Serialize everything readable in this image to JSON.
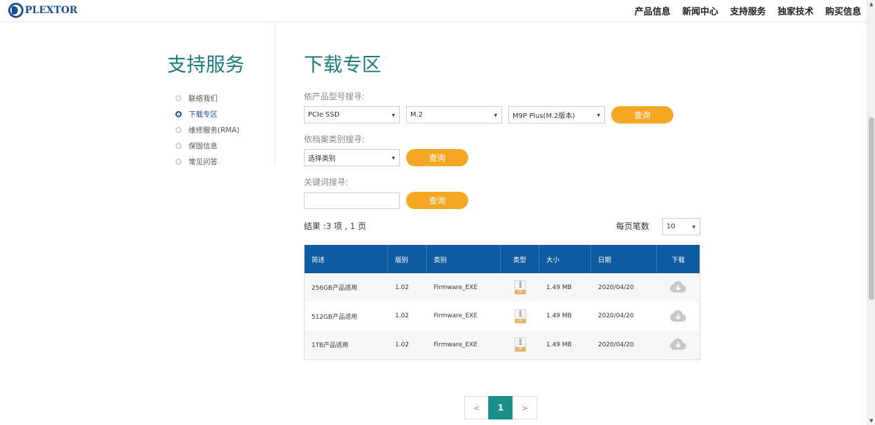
{
  "header": {
    "logo_text": "PLEXTOR",
    "nav": [
      "产品信息",
      "新闻中心",
      "支持服务",
      "独家技术",
      "购买信息"
    ]
  },
  "sidebar": {
    "title": "支持服务",
    "items": [
      {
        "label": "联络我们",
        "active": false
      },
      {
        "label": "下载专区",
        "active": true
      },
      {
        "label": "维修服务(RMA)",
        "active": false
      },
      {
        "label": "保固信息",
        "active": false
      },
      {
        "label": "常见问答",
        "active": false
      }
    ]
  },
  "main": {
    "title": "下载专区",
    "product_search": {
      "label": "依产品型号搜寻:",
      "select1": "PCIe SSD",
      "select2": "M.2",
      "select3": "M9P Plus(M.2版本)",
      "button": "查询"
    },
    "category_search": {
      "label": "依档案类别搜寻:",
      "select": "选择类别",
      "button": "查询"
    },
    "keyword_search": {
      "label": "关键词搜寻:",
      "value": "",
      "button": "查询"
    },
    "results": {
      "prefix": "结果 :",
      "count": "3",
      "mid": " 项 , ",
      "pages": "1",
      "suffix": " 页"
    },
    "per_page": {
      "label": "每页笔数",
      "value": "10"
    },
    "table": {
      "headers": [
        "简述",
        "版别",
        "类别",
        "类型",
        "大小",
        "日期",
        "下载"
      ],
      "rows": [
        {
          "desc": "256GB产品适用",
          "version": "1.02",
          "category": "Firmware_EXE",
          "type_icon": "zip-file-icon",
          "size": "1.49 MB",
          "date": "2020/04/20"
        },
        {
          "desc": "512GB产品适用",
          "version": "1.02",
          "category": "Firmware_EXE",
          "type_icon": "zip-file-icon",
          "size": "1.49 MB",
          "date": "2020/04/20"
        },
        {
          "desc": "1TB产品适用",
          "version": "1.02",
          "category": "Firmware_EXE",
          "type_icon": "zip-file-icon",
          "size": "1.49 MB",
          "date": "2020/04/20"
        }
      ]
    },
    "pagination": {
      "prev": "<",
      "current": "1",
      "next": ">"
    }
  },
  "colors": {
    "brand_blue": "#1d4f91",
    "teal_title": "#1d7c7a",
    "button_orange": "#f5a623",
    "table_header": "#0e5b9f",
    "pager_active": "#1a8f89"
  }
}
